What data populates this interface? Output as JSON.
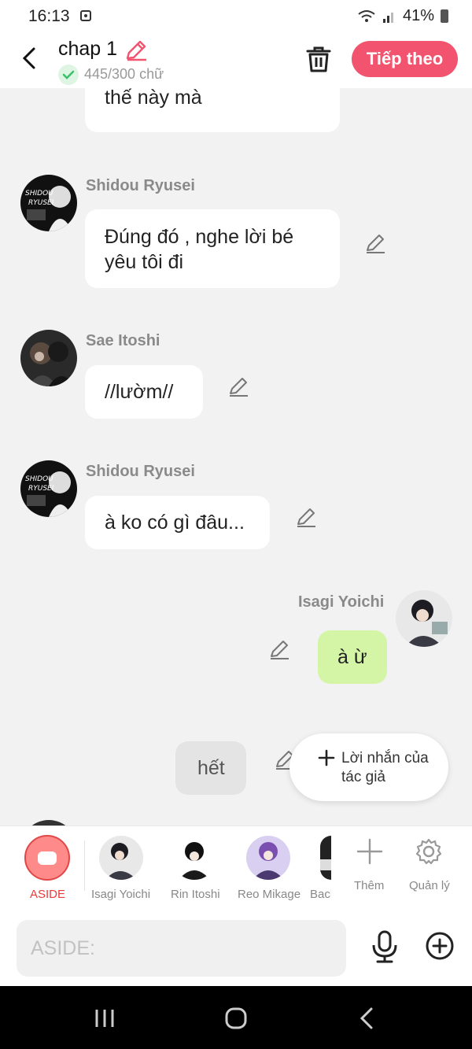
{
  "status_bar": {
    "time": "16:13",
    "battery": "41%"
  },
  "header": {
    "title": "chap 1",
    "word_count": "445/300 chữ",
    "next_label": "Tiếp theo"
  },
  "messages": [
    {
      "side": "left",
      "text": "chúng tôi mà cậu bị như thế này mà",
      "partial": true
    },
    {
      "side": "left",
      "name": "Shidou Ryusei",
      "text": "Đúng đó , nghe lời bé yêu tôi đi"
    },
    {
      "side": "left",
      "name": "Sae Itoshi",
      "text": "//lườm//"
    },
    {
      "side": "left",
      "name": "Shidou Ryusei",
      "text": "à ko có gì đâu..."
    },
    {
      "side": "right",
      "name": "Isagi Yoichi",
      "text": "à ừ"
    },
    {
      "side": "right",
      "text": "hết"
    }
  ],
  "author_note_popup": {
    "label": "Lời nhắn của tác giả"
  },
  "character_bar": {
    "aside_label": "ASIDE",
    "characters": [
      {
        "name": "Isagi Yoichi"
      },
      {
        "name": "Rin Itoshi"
      },
      {
        "name": "Reo Mikage"
      },
      {
        "name": "Bach"
      }
    ],
    "add_label": "Thêm",
    "manage_label": "Quản lý"
  },
  "input_bar": {
    "placeholder": "ASIDE:"
  },
  "colors": {
    "accent": "#f2546f",
    "green_bubble": "#d4f5a6",
    "aside_red": "#e83b3b"
  }
}
